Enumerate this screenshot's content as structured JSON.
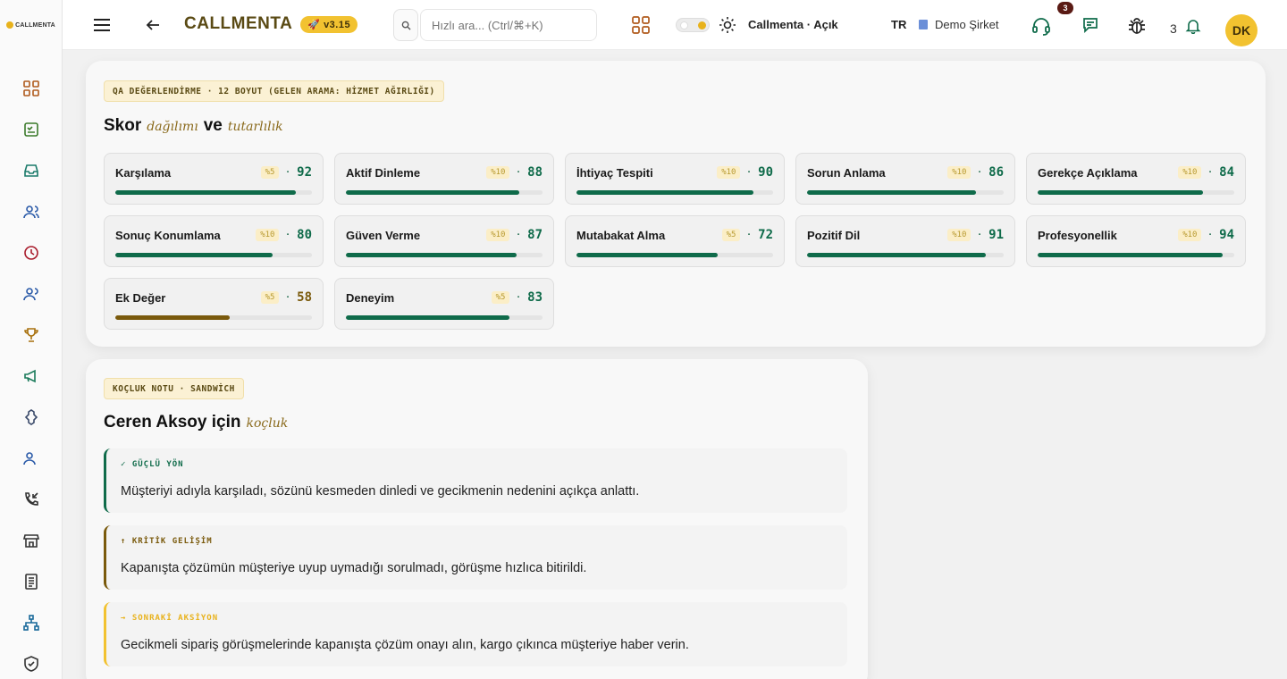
{
  "app": {
    "logo": "CALLMENTA",
    "brand": "CALLMENTA",
    "version": "v3.15",
    "theme_label": "Callmenta · Açık",
    "lang": "TR",
    "company": "Demo Şirket",
    "support_badge": "3",
    "notif_count": "3",
    "avatar": "DK"
  },
  "search": {
    "placeholder": "Hızlı ara... (Ctrl/⌘+K)"
  },
  "sidebar": {
    "icons": [
      "dashboard-icon",
      "checklist-icon",
      "inbox-icon",
      "users-icon",
      "clock-icon",
      "team-icon",
      "trophy-icon",
      "megaphone-icon",
      "puzzle-icon",
      "agents-icon",
      "call-incoming-icon",
      "store-icon",
      "report-icon",
      "hierarchy-icon",
      "shield-icon"
    ]
  },
  "qa": {
    "tag": "QA DEĞERLENDİRME · 12 BOYUT (GELEN ARAMA: HİZMET AĞIRLIĞI)",
    "title_a": "Skor",
    "title_b": "dağılımı",
    "title_c": "ve",
    "title_d": "tutarlılık",
    "metrics": [
      {
        "name": "Karşılama",
        "weight": "%5",
        "score": "92",
        "value": 92
      },
      {
        "name": "Aktif Dinleme",
        "weight": "%10",
        "score": "88",
        "value": 88
      },
      {
        "name": "İhtiyaç Tespiti",
        "weight": "%10",
        "score": "90",
        "value": 90
      },
      {
        "name": "Sorun Anlama",
        "weight": "%10",
        "score": "86",
        "value": 86
      },
      {
        "name": "Gerekçe Açıklama",
        "weight": "%10",
        "score": "84",
        "value": 84
      },
      {
        "name": "Sonuç Konumlama",
        "weight": "%10",
        "score": "80",
        "value": 80
      },
      {
        "name": "Güven Verme",
        "weight": "%10",
        "score": "87",
        "value": 87
      },
      {
        "name": "Mutabakat Alma",
        "weight": "%5",
        "score": "72",
        "value": 72
      },
      {
        "name": "Pozitif Dil",
        "weight": "%10",
        "score": "91",
        "value": 91
      },
      {
        "name": "Profesyonellik",
        "weight": "%10",
        "score": "94",
        "value": 94
      },
      {
        "name": "Ek Değer",
        "weight": "%5",
        "score": "58",
        "value": 58
      },
      {
        "name": "Deneyim",
        "weight": "%5",
        "score": "83",
        "value": 83
      }
    ]
  },
  "coach": {
    "tag": "KOÇLUK NOTU · SANDWİCH",
    "title": "Ceren Aksoy için",
    "title_accent": "koçluk",
    "notes": [
      {
        "label": "✓ GÜÇLÜ YÖN",
        "text": "Müşteriyi adıyla karşıladı, sözünü kesmeden dinledi ve gecikmenin nedenini açıkça anlattı."
      },
      {
        "label": "↑ KRİTİK GELİŞİM",
        "text": "Kapanışta çözümün müşteriye uyup uymadığı sorulmadı, görüşme hızlıca bitirildi."
      },
      {
        "label": "→ SONRAKİ AKSİYON",
        "text": "Gecikmeli sipariş görüşmelerinde kapanışta çözüm onayı alın, kargo çıkınca müşteriye haber verin."
      }
    ]
  }
}
